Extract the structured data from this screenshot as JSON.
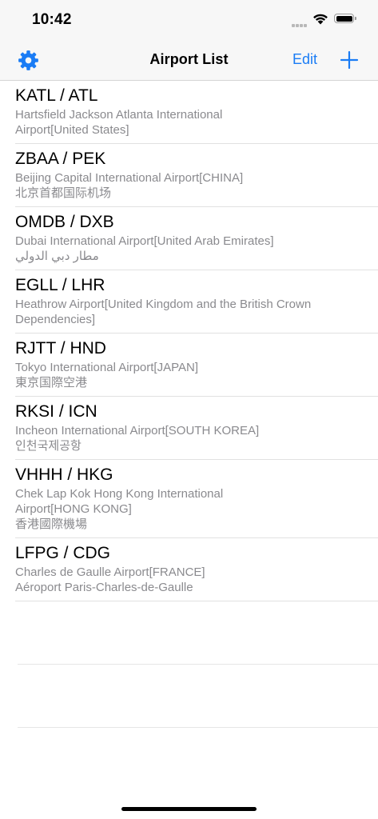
{
  "status_bar": {
    "time": "10:42"
  },
  "nav": {
    "title": "Airport List",
    "edit_label": "Edit",
    "settings_icon": "gear-icon",
    "add_icon": "plus-icon"
  },
  "colors": {
    "accent": "#1a7cf5",
    "secondary_text": "#8a8a8e"
  },
  "airports": [
    {
      "code": "KATL / ATL",
      "name": "Hartsfield Jackson Atlanta International Airport[United States]",
      "local": ""
    },
    {
      "code": "ZBAA / PEK",
      "name": "Beijing Capital International Airport[CHINA]",
      "local": "北京首都国际机场"
    },
    {
      "code": "OMDB / DXB",
      "name": "Dubai International Airport[United Arab Emirates]",
      "local": "مطار دبي الدولي"
    },
    {
      "code": "EGLL / LHR",
      "name": "Heathrow Airport[United Kingdom and the British Crown Dependencies]",
      "local": ""
    },
    {
      "code": "RJTT / HND",
      "name": "Tokyo International Airport[JAPAN]",
      "local": "東京国際空港"
    },
    {
      "code": "RKSI / ICN",
      "name": "Incheon International Airport[SOUTH KOREA]",
      "local": "인천국제공항"
    },
    {
      "code": "VHHH / HKG",
      "name": "Chek Lap Kok Hong Kong International Airport[HONG KONG]",
      "local": "香港國際機場"
    },
    {
      "code": "LFPG / CDG",
      "name": "Charles de Gaulle Airport[FRANCE]",
      "local": "Aéroport Paris-Charles-de-Gaulle"
    }
  ]
}
